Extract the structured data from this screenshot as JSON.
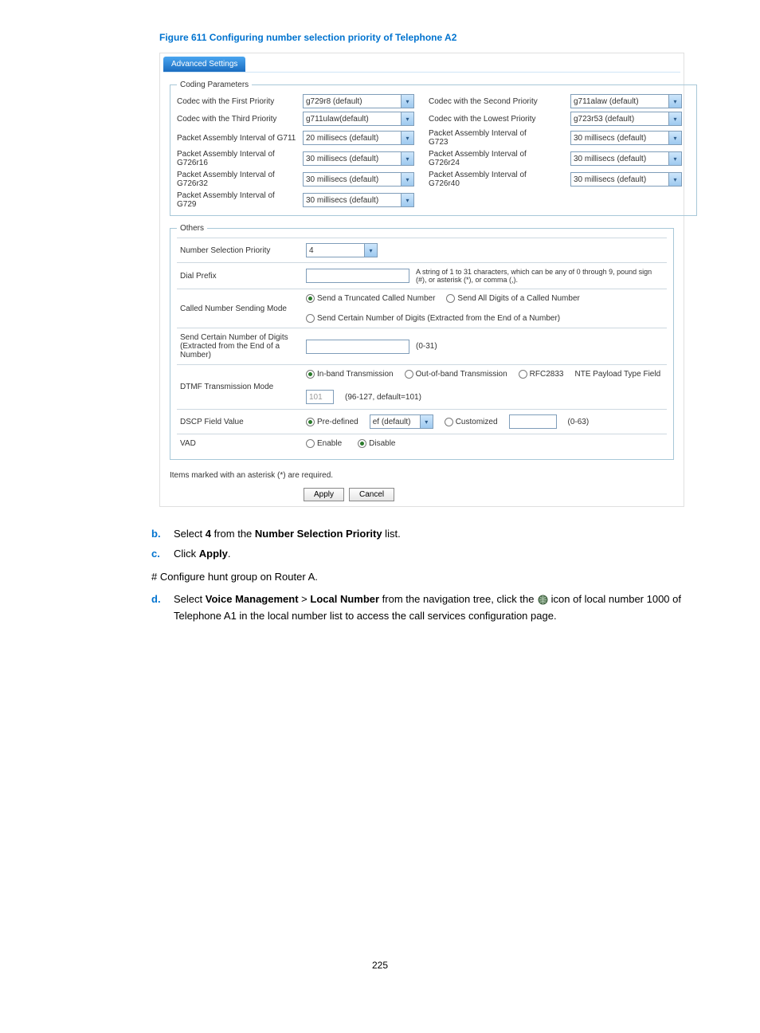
{
  "figure_title": "Figure 611 Configuring number selection priority of Telephone A2",
  "tab_label": "Advanced Settings",
  "coding": {
    "legend": "Coding Parameters",
    "rows": [
      {
        "l1": "Codec with the First Priority",
        "v1": "g729r8 (default)",
        "l2": "Codec with the Second Priority",
        "v2": "g711alaw (default)"
      },
      {
        "l1": "Codec with the Third Priority",
        "v1": "g711ulaw(default)",
        "l2": "Codec with the Lowest Priority",
        "v2": "g723r53 (default)"
      },
      {
        "l1": "Packet Assembly Interval of G711",
        "v1": "20 millisecs (default)",
        "l2": "Packet Assembly Interval of G723",
        "v2": "30 millisecs (default)"
      },
      {
        "l1": "Packet Assembly Interval of G726r16",
        "v1": "30 millisecs (default)",
        "l2": "Packet Assembly Interval of G726r24",
        "v2": "30 millisecs (default)"
      },
      {
        "l1": "Packet Assembly Interval of G726r32",
        "v1": "30 millisecs (default)",
        "l2": "Packet Assembly Interval of G726r40",
        "v2": "30 millisecs (default)"
      },
      {
        "l1": "Packet Assembly Interval of G729",
        "v1": "30 millisecs (default)",
        "l2": "",
        "v2": ""
      }
    ]
  },
  "others": {
    "legend": "Others",
    "nsp_label": "Number Selection Priority",
    "nsp_value": "4",
    "dial_prefix_label": "Dial Prefix",
    "dial_prefix_hint": "A string of 1 to 31 characters, which can be any of 0 through 9, pound sign (#), or asterisk (*), or comma (,).",
    "cnsm_label": "Called Number Sending Mode",
    "cnsm_opts": [
      "Send a Truncated Called Number",
      "Send All Digits of a Called Number",
      "Send Certain Number of Digits (Extracted from the End of a Number)"
    ],
    "scnd_label": "Send Certain Number of Digits (Extracted from the End of a Number)",
    "scnd_hint": "(0-31)",
    "dtmf_label": "DTMF Transmission Mode",
    "dtmf_opts": [
      "In-band Transmission",
      "Out-of-band Transmission",
      "RFC2833"
    ],
    "nte_label": "NTE Payload Type Field",
    "nte_value": "101",
    "nte_hint": "(96-127, default=101)",
    "dscp_label": "DSCP Field Value",
    "dscp_opts": [
      "Pre-defined",
      "Customized"
    ],
    "dscp_select": "ef (default)",
    "dscp_hint": "(0-63)",
    "vad_label": "VAD",
    "vad_opts": [
      "Enable",
      "Disable"
    ]
  },
  "required_note": "Items marked with an asterisk (*) are required.",
  "buttons": {
    "apply": "Apply",
    "cancel": "Cancel"
  },
  "steps": {
    "b": {
      "letter": "b.",
      "pre": "Select ",
      "bold1": "4",
      "mid": " from the ",
      "bold2": "Number Selection Priority",
      "post": " list."
    },
    "c": {
      "letter": "c.",
      "pre": "Click ",
      "bold1": "Apply",
      "post": "."
    },
    "hash": "# Configure hunt group on Router A.",
    "d": {
      "letter": "d.",
      "pre": "Select ",
      "bold1": "Voice Management",
      "gt": " > ",
      "bold2": "Local Number",
      "mid": " from the navigation tree, click the ",
      "post": " icon of local number 1000 of Telephone A1 in the local number list to access the call services configuration page."
    }
  },
  "page_number": "225"
}
